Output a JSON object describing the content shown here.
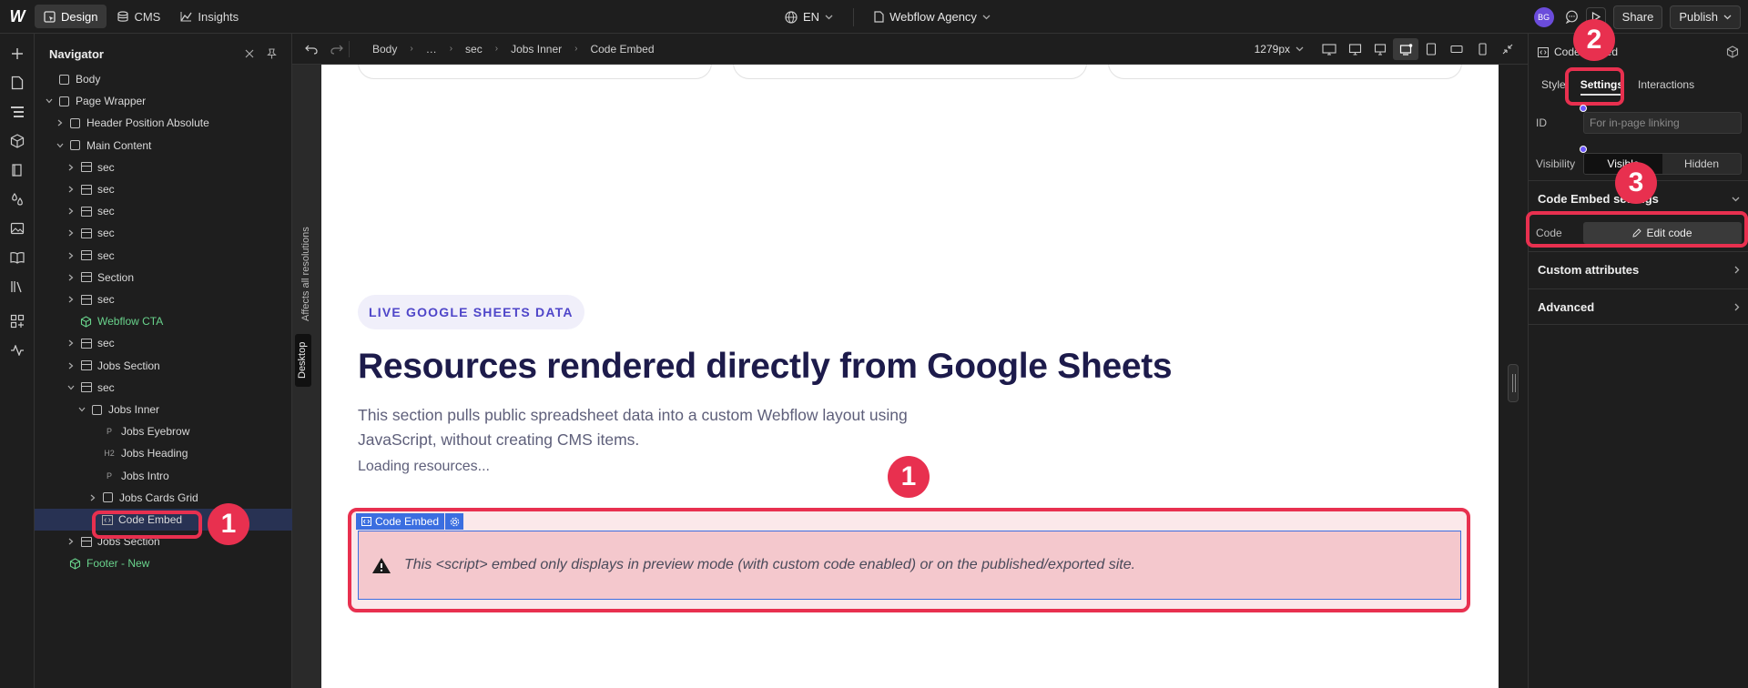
{
  "topbar": {
    "modes": [
      {
        "label": "Design",
        "icon": "design-icon",
        "active": true
      },
      {
        "label": "CMS",
        "icon": "database-icon",
        "active": false
      },
      {
        "label": "Insights",
        "icon": "chart-icon",
        "active": false
      }
    ],
    "locale": "EN",
    "site_name": "Webflow Agency",
    "avatar_initials": "BG",
    "share_label": "Share",
    "publish_label": "Publish"
  },
  "navigator": {
    "title": "Navigator",
    "items": [
      {
        "label": "Body"
      },
      {
        "label": "Page Wrapper"
      },
      {
        "label": "Header Position Absolute"
      },
      {
        "label": "Main Content"
      },
      {
        "label": "sec"
      },
      {
        "label": "sec"
      },
      {
        "label": "sec"
      },
      {
        "label": "sec"
      },
      {
        "label": "sec"
      },
      {
        "label": "Section"
      },
      {
        "label": "sec"
      },
      {
        "label": "Webflow CTA"
      },
      {
        "label": "sec"
      },
      {
        "label": "Jobs Section"
      },
      {
        "label": "sec"
      },
      {
        "label": "Jobs Inner"
      },
      {
        "label": "Jobs Eyebrow",
        "tag": "P"
      },
      {
        "label": "Jobs Heading",
        "tag": "H2"
      },
      {
        "label": "Jobs Intro",
        "tag": "P"
      },
      {
        "label": "Jobs Cards Grid"
      },
      {
        "label": "Code Embed"
      },
      {
        "label": "Jobs Section"
      },
      {
        "label": "Footer - New"
      }
    ]
  },
  "breadcrumb": {
    "items": [
      "Body",
      "…",
      "sec",
      "Jobs Inner",
      "Code Embed"
    ],
    "width_readout": "1279px"
  },
  "side_labels": {
    "affects": "Affects all resolutions",
    "breakpoint": "Desktop"
  },
  "canvas": {
    "eyebrow": "LIVE GOOGLE SHEETS DATA",
    "heading": "Resources rendered directly from Google Sheets",
    "intro": "This section pulls public spreadsheet data into a custom Webflow layout using JavaScript, without creating CMS items.",
    "loading": "Loading resources...",
    "embed_label": "Code Embed",
    "embed_message": "This <script> embed only displays in preview mode (with custom code enabled) or on the published/exported site."
  },
  "right_panel": {
    "element_name": "Code Embed",
    "tabs": [
      "Style",
      "Settings",
      "Interactions"
    ],
    "id_label": "ID",
    "id_placeholder": "For in-page linking",
    "visibility_label": "Visibility",
    "visible_label": "Visible",
    "hidden_label": "Hidden",
    "embed_settings_title": "Code Embed settings",
    "code_label": "Code",
    "edit_code_label": "Edit code",
    "custom_attributes": "Custom attributes",
    "advanced": "Advanced"
  },
  "annotations": {
    "badge_1": "1",
    "badge_2": "2",
    "badge_3": "3",
    "color": "#e8304f"
  }
}
